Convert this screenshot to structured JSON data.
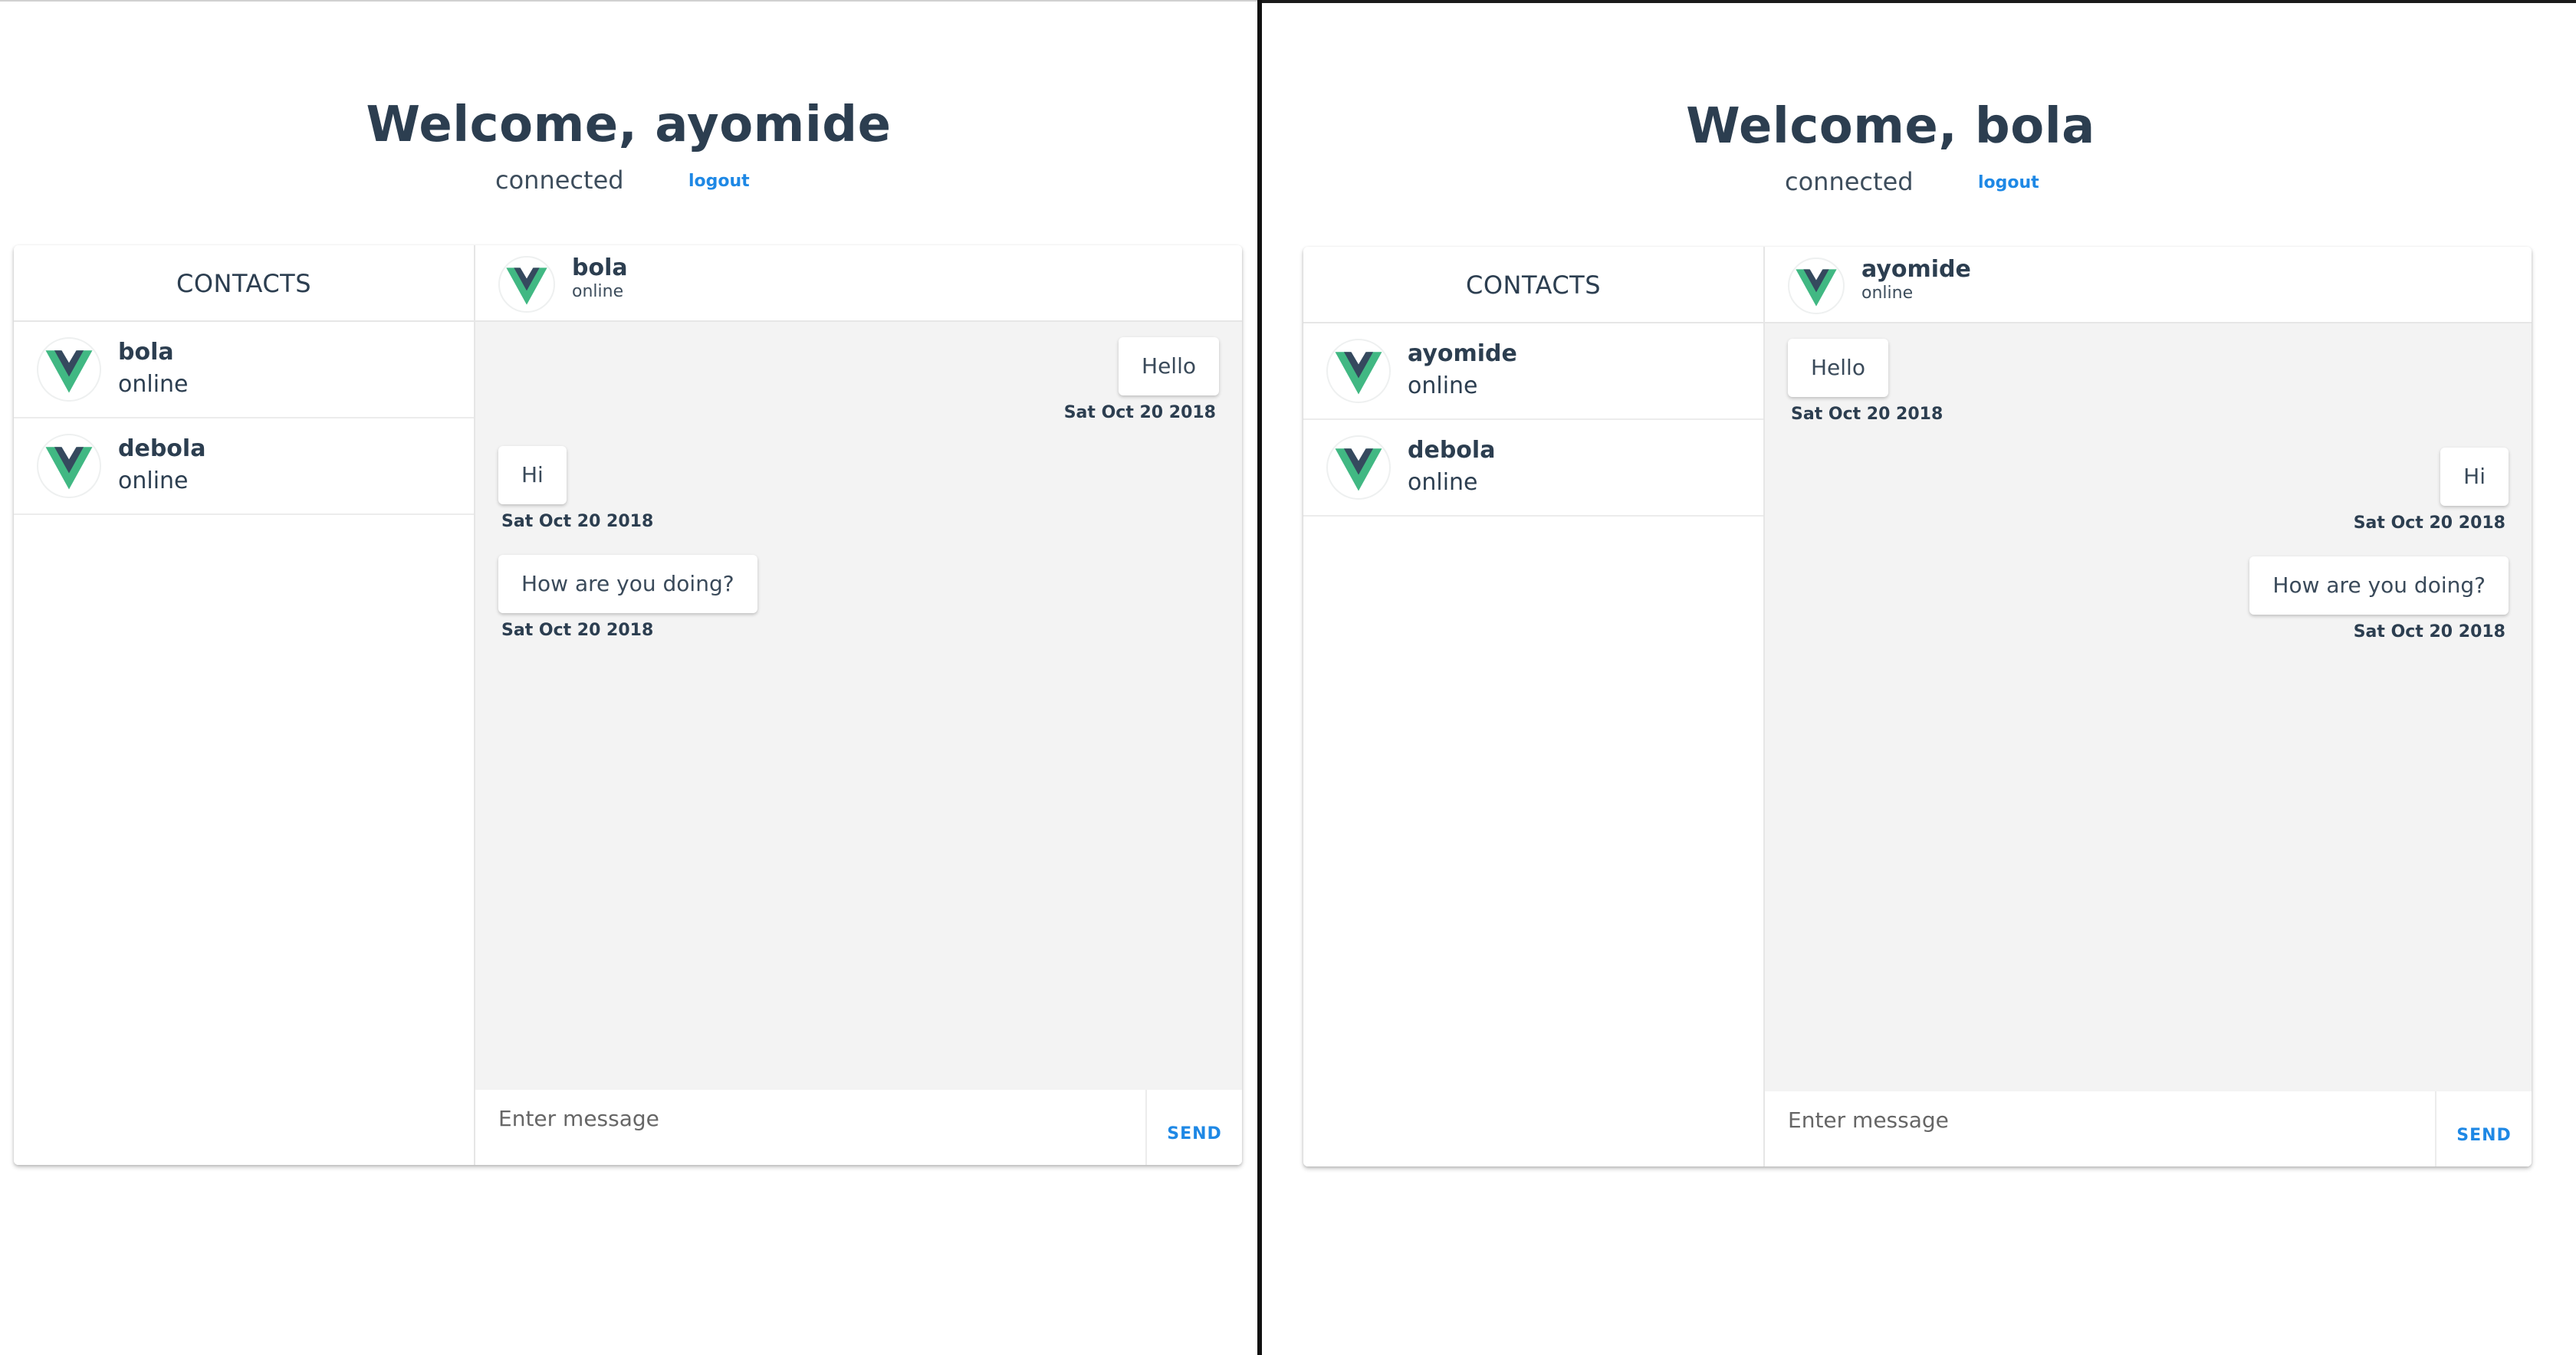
{
  "left_pane": {
    "welcome": "Welcome, ayomide",
    "status": "connected",
    "logout": "logout",
    "contacts_header": "CONTACTS",
    "contacts": [
      {
        "name": "bola",
        "status": "online"
      },
      {
        "name": "debola",
        "status": "online"
      }
    ],
    "chat": {
      "name": "bola",
      "status": "online",
      "messages": [
        {
          "text": "Hello",
          "date": "Sat Oct 20 2018",
          "side": "mine"
        },
        {
          "text": "Hi",
          "date": "Sat Oct 20 2018",
          "side": "theirs"
        },
        {
          "text": "How are you doing?",
          "date": "Sat Oct 20 2018",
          "side": "theirs"
        }
      ]
    },
    "input_placeholder": "Enter message",
    "send": "SEND"
  },
  "right_pane": {
    "welcome": "Welcome, bola",
    "status": "connected",
    "logout": "logout",
    "contacts_header": "CONTACTS",
    "contacts": [
      {
        "name": "ayomide",
        "status": "online"
      },
      {
        "name": "debola",
        "status": "online"
      }
    ],
    "chat": {
      "name": "ayomide",
      "status": "online",
      "messages": [
        {
          "text": "Hello",
          "date": "Sat Oct 20 2018",
          "side": "theirs"
        },
        {
          "text": "Hi",
          "date": "Sat Oct 20 2018",
          "side": "mine"
        },
        {
          "text": "How are you doing?",
          "date": "Sat Oct 20 2018",
          "side": "mine"
        }
      ]
    },
    "input_placeholder": "Enter message",
    "send": "SEND"
  },
  "colors": {
    "text_dark": "#2c3e50",
    "link_blue": "#1e88e5",
    "chat_background": "#f3f3f3",
    "vue_green": "#41b883",
    "vue_navy": "#35495e"
  },
  "icons": {
    "avatar": "vue-logo-icon"
  }
}
